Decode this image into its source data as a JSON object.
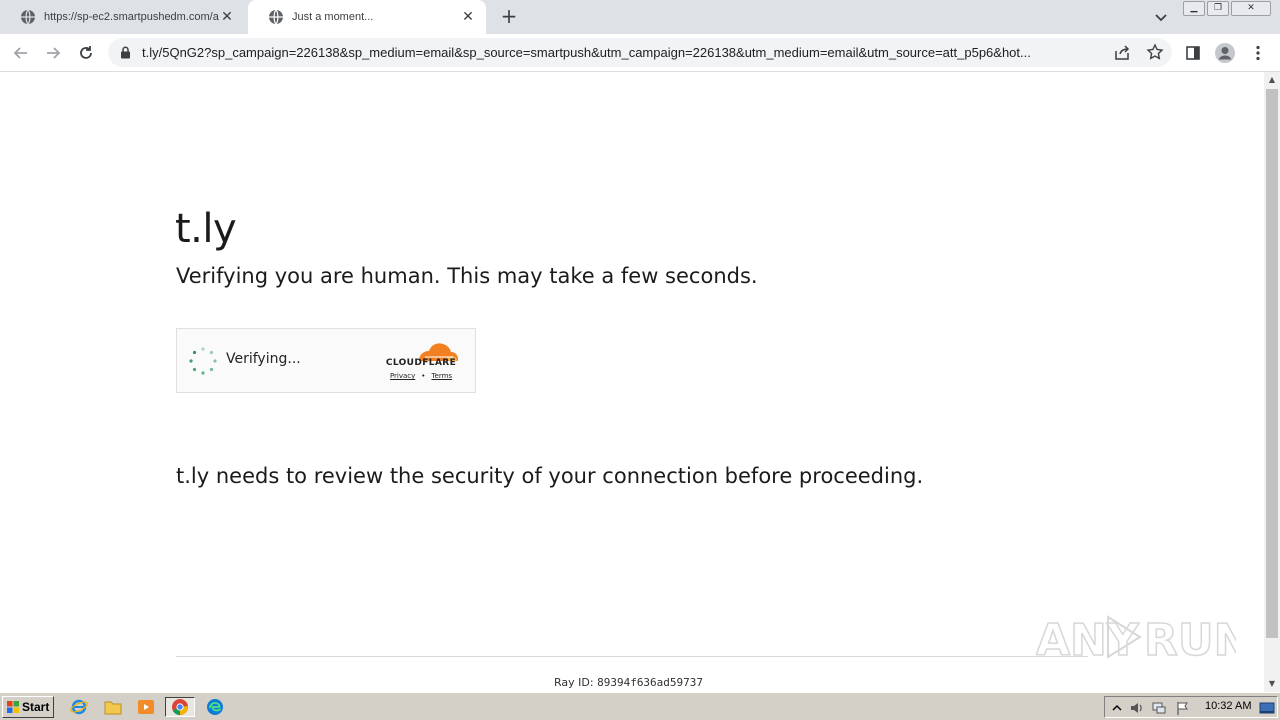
{
  "browser": {
    "tabs": [
      {
        "title": "https://sp-ec2.smartpushedm.com/a",
        "active": false
      },
      {
        "title": "Just a moment...",
        "active": true
      }
    ],
    "new_tab_label": "+",
    "address": "t.ly/5QnG2?sp_campaign=226138&sp_medium=email&sp_source=smartpush&utm_campaign=226138&utm_medium=email&utm_source=att_p5p6&hot..."
  },
  "page": {
    "site_name": "t.ly",
    "subtitle": "Verifying you are human. This may take a few seconds.",
    "widget": {
      "status": "Verifying...",
      "brand": "CLOUDFLARE",
      "privacy_link": "Privacy",
      "separator": "•",
      "terms_link": "Terms"
    },
    "review_text": "t.ly needs to review the security of your connection before proceeding.",
    "ray_label": "Ray ID:",
    "ray_id": "89394f636ad59737",
    "watermark": "ANY RUN"
  },
  "taskbar": {
    "start_label": "Start",
    "clock": "10:32 AM"
  },
  "colors": {
    "cloudflare_orange": "#f38020",
    "spinner_green": "#1a8e4f",
    "tabstrip_bg": "#dee1e6"
  }
}
